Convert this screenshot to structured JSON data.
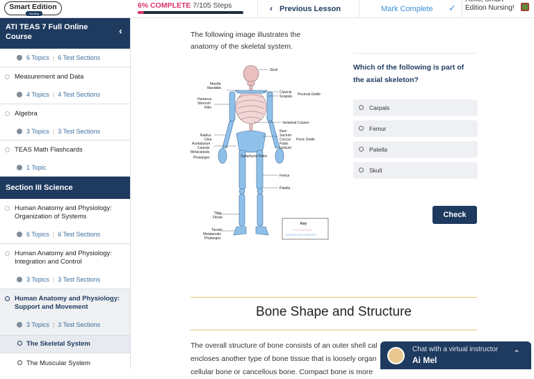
{
  "header": {
    "logo_main": "Smart Edition",
    "logo_sub": "Nursing",
    "progress_complete": "6% COMPLETE",
    "progress_steps": "7/105 Steps",
    "progress_percent": 6,
    "prev_label": "Previous Lesson",
    "mark_label": "Mark Complete",
    "greeting": "Hello, Smart Edition Nursing!"
  },
  "sidebar": {
    "course_title": "ATI TEAS 7 Full Online Course",
    "section3_title": "Section III Science",
    "groups": [
      {
        "label": "",
        "topics": "6 Topics",
        "tests": "6 Test Sections"
      },
      {
        "label": "Measurement and Data",
        "topics": "4 Topics",
        "tests": "4 Test Sections"
      },
      {
        "label": "Algebra",
        "topics": "3 Topics",
        "tests": "3 Test Sections"
      },
      {
        "label": "TEAS Math Flashcards",
        "topics": "1 Topic",
        "tests": ""
      },
      {
        "label": "Human Anatomy and Physiology: Organization of Systems",
        "topics": "6 Topics",
        "tests": "6 Test Sections"
      },
      {
        "label": "Human Anatomy and Physiology: Integration and Control",
        "topics": "3 Topics",
        "tests": "3 Test Sections"
      },
      {
        "label": "Human Anatomy and Physiology: Support and Movement",
        "topics": "3 Topics",
        "tests": "3 Test Sections"
      }
    ],
    "lesson_active": "The Skeletal System",
    "lesson_next": "The Muscular System"
  },
  "main": {
    "intro_line1": "The following image illustrates the",
    "intro_line2": "anatomy of the skeletal system.",
    "question": "Which of the following is part of the axial skeleton?",
    "options": [
      "Carpals",
      "Femur",
      "Patella",
      "Skull"
    ],
    "check_label": "Check",
    "section_title": "Bone Shape and Structure",
    "body_line1": "The overall structure of bone consists of an outer shell cal",
    "body_line2": "encloses another type of bone tissue that is loosely organ",
    "body_line3": "cellular bone or cancellous bone. Compact bone is more"
  },
  "figure": {
    "labels_right": [
      "Skull",
      "Clavicle",
      "Scapula",
      "Pectoral Girdle",
      "Vertebral Column",
      "Ilium",
      "Sacrum",
      "Coccyx",
      "Pubis",
      "Ischium",
      "Pevic Girdle",
      "Femur",
      "Patella"
    ],
    "labels_left": [
      "Maxilla",
      "Mandible",
      "Humerus",
      "Sternum",
      "Ribs",
      "Radius",
      "Ulna",
      "Acetabulum",
      "Carpals",
      "Metacarpals",
      "Phalanges",
      "Tibia",
      "Fibula",
      "Tarsals",
      "Metatarsals",
      "Phalanges"
    ],
    "label_center": "Symphysis Pubis",
    "key_title": "Key",
    "key_axial": "Axial Skeleton",
    "key_appendicular": "Appendicular Skeleton",
    "colors": {
      "axial": "#e9bfbf",
      "appendicular": "#8fc0ea"
    }
  },
  "chat": {
    "line1": "Chat with a virtual instructor",
    "line2": "Ai Mel"
  }
}
